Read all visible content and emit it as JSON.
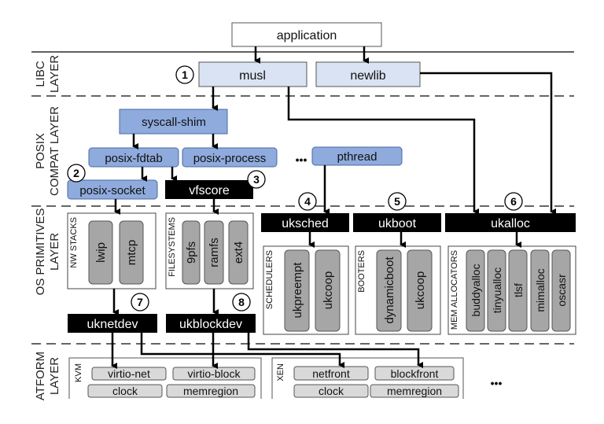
{
  "application": "application",
  "libc": {
    "layer_label_1": "LIBC",
    "layer_label_2": "LAYER",
    "musl": "musl",
    "newlib": "newlib"
  },
  "posix": {
    "layer_label_1": "POSIX",
    "layer_label_2": "COMPAT LAYER",
    "syscall_shim": "syscall-shim",
    "posix_fdtab": "posix-fdtab",
    "posix_process": "posix-process",
    "posix_socket": "posix-socket",
    "vfscore": "vfscore",
    "pthread": "pthread",
    "ellipsis": "•••"
  },
  "os": {
    "layer_label_1": "OS PRIMITIVES",
    "layer_label_2": "LAYER",
    "nw_stacks": {
      "title": "NW STACKS",
      "items": [
        "lwip",
        "mtcp"
      ]
    },
    "filesystems": {
      "title": "FILESYSTEMS",
      "items": [
        "9pfs",
        "ramfs",
        "ext4"
      ]
    },
    "uksched": "uksched",
    "ukboot": "ukboot",
    "ukalloc": "ukalloc",
    "schedulers": {
      "title": "SCHEDULERS",
      "items": [
        "ukpreempt",
        "ukcoop"
      ]
    },
    "booters": {
      "title": "BOOTERS",
      "items": [
        "dynamicboot",
        "ukcoop"
      ]
    },
    "allocators": {
      "title": "MEM ALLOCATORS",
      "items": [
        "buddyalloc",
        "tinyualloc",
        "tlsf",
        "mimalloc",
        "oscasr"
      ]
    },
    "uknetdev": "uknetdev",
    "ukblockdev": "ukblockdev"
  },
  "platform": {
    "layer_label_1": "ATFORM",
    "layer_label_2": "LAYER",
    "kvm": {
      "title": "KVM",
      "items": [
        "virtio-net",
        "virtio-block",
        "clock",
        "memregion"
      ]
    },
    "xen": {
      "title": "XEN",
      "items": [
        "netfront",
        "blockfront",
        "clock",
        "memregion"
      ]
    },
    "ellipsis": "•••"
  },
  "markers": [
    "1",
    "2",
    "3",
    "4",
    "5",
    "6",
    "7",
    "8"
  ],
  "colors": {
    "libc_fill": "#dae3f3",
    "posix_fill": "#8faadc",
    "core_fill": "#000000",
    "lib_fill": "#a6a6a6",
    "plat_fill": "#d9d9d9"
  }
}
